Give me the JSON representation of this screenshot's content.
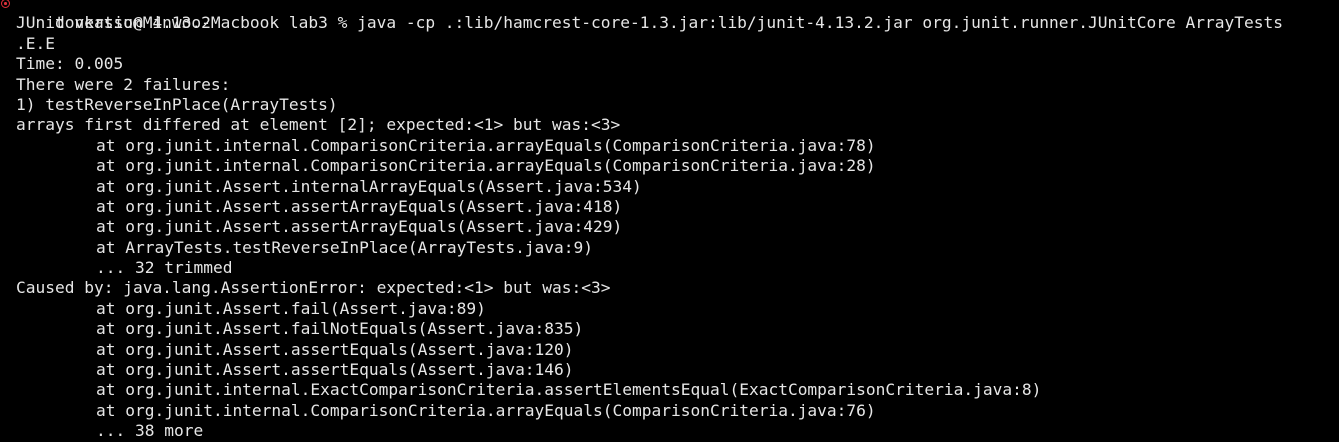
{
  "colors": {
    "background": "#000000",
    "text": "#e6e6e6",
    "status_error": "#e0303a"
  },
  "terminal": {
    "prompt_line": "donkatsu@Minwoo-Macbook lab3 % java -cp .:lib/hamcrest-core-1.3.jar:lib/junit-4.13.2.jar org.junit.runner.JUnitCore ArrayTests",
    "status_icon": "error-circle-icon",
    "lines": [
      "JUnit version 4.13.2",
      ".E.E",
      "Time: 0.005",
      "There were 2 failures:",
      "1) testReverseInPlace(ArrayTests)",
      "arrays first differed at element [2]; expected:<1> but was:<3>"
    ],
    "stack1": [
      "at org.junit.internal.ComparisonCriteria.arrayEquals(ComparisonCriteria.java:78)",
      "at org.junit.internal.ComparisonCriteria.arrayEquals(ComparisonCriteria.java:28)",
      "at org.junit.Assert.internalArrayEquals(Assert.java:534)",
      "at org.junit.Assert.assertArrayEquals(Assert.java:418)",
      "at org.junit.Assert.assertArrayEquals(Assert.java:429)",
      "at ArrayTests.testReverseInPlace(ArrayTests.java:9)",
      "... 32 trimmed"
    ],
    "caused_by": "Caused by: java.lang.AssertionError: expected:<1> but was:<3>",
    "stack2": [
      "at org.junit.Assert.fail(Assert.java:89)",
      "at org.junit.Assert.failNotEquals(Assert.java:835)",
      "at org.junit.Assert.assertEquals(Assert.java:120)",
      "at org.junit.Assert.assertEquals(Assert.java:146)",
      "at org.junit.internal.ExactComparisonCriteria.assertElementsEqual(ExactComparisonCriteria.java:8)",
      "at org.junit.internal.ComparisonCriteria.arrayEquals(ComparisonCriteria.java:76)",
      "... 38 more"
    ]
  }
}
